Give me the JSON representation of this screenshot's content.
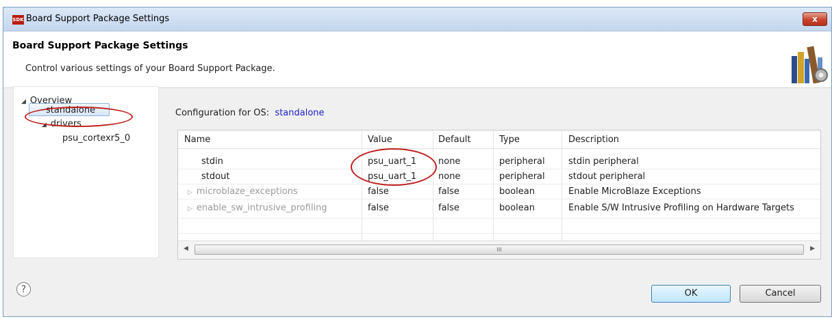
{
  "window": {
    "title": "Board Support Package Settings",
    "app_badge": "SDK",
    "close_label": "x"
  },
  "banner": {
    "title": "Board Support Package Settings",
    "description": "Control various settings of your Board Support Package."
  },
  "tree": {
    "overview": "Overview",
    "standalone": "standalone",
    "drivers": "drivers",
    "processor": "psu_cortexr5_0"
  },
  "config": {
    "label": "Configuration for OS:",
    "os": "standalone"
  },
  "table": {
    "columns": [
      "Name",
      "Value",
      "Default",
      "Type",
      "Description"
    ],
    "rows": [
      {
        "name": "stdin",
        "value": "psu_uart_1",
        "default": "none",
        "type": "peripheral",
        "description": "stdin peripheral",
        "expandable": false
      },
      {
        "name": "stdout",
        "value": "psu_uart_1",
        "default": "none",
        "type": "peripheral",
        "description": "stdout peripheral",
        "expandable": false
      },
      {
        "name": "microblaze_exceptions",
        "value": "false",
        "default": "false",
        "type": "boolean",
        "description": "Enable MicroBlaze Exceptions",
        "expandable": true
      },
      {
        "name": "enable_sw_intrusive_profiling",
        "value": "false",
        "default": "false",
        "type": "boolean",
        "description": "Enable S/W Intrusive Profiling on Hardware Targets",
        "expandable": true
      }
    ],
    "scroll_grip": "III"
  },
  "buttons": {
    "help": "?",
    "ok": "OK",
    "cancel": "Cancel"
  },
  "colors": {
    "annotation": "#c01e1e",
    "link": "#2020cc"
  }
}
